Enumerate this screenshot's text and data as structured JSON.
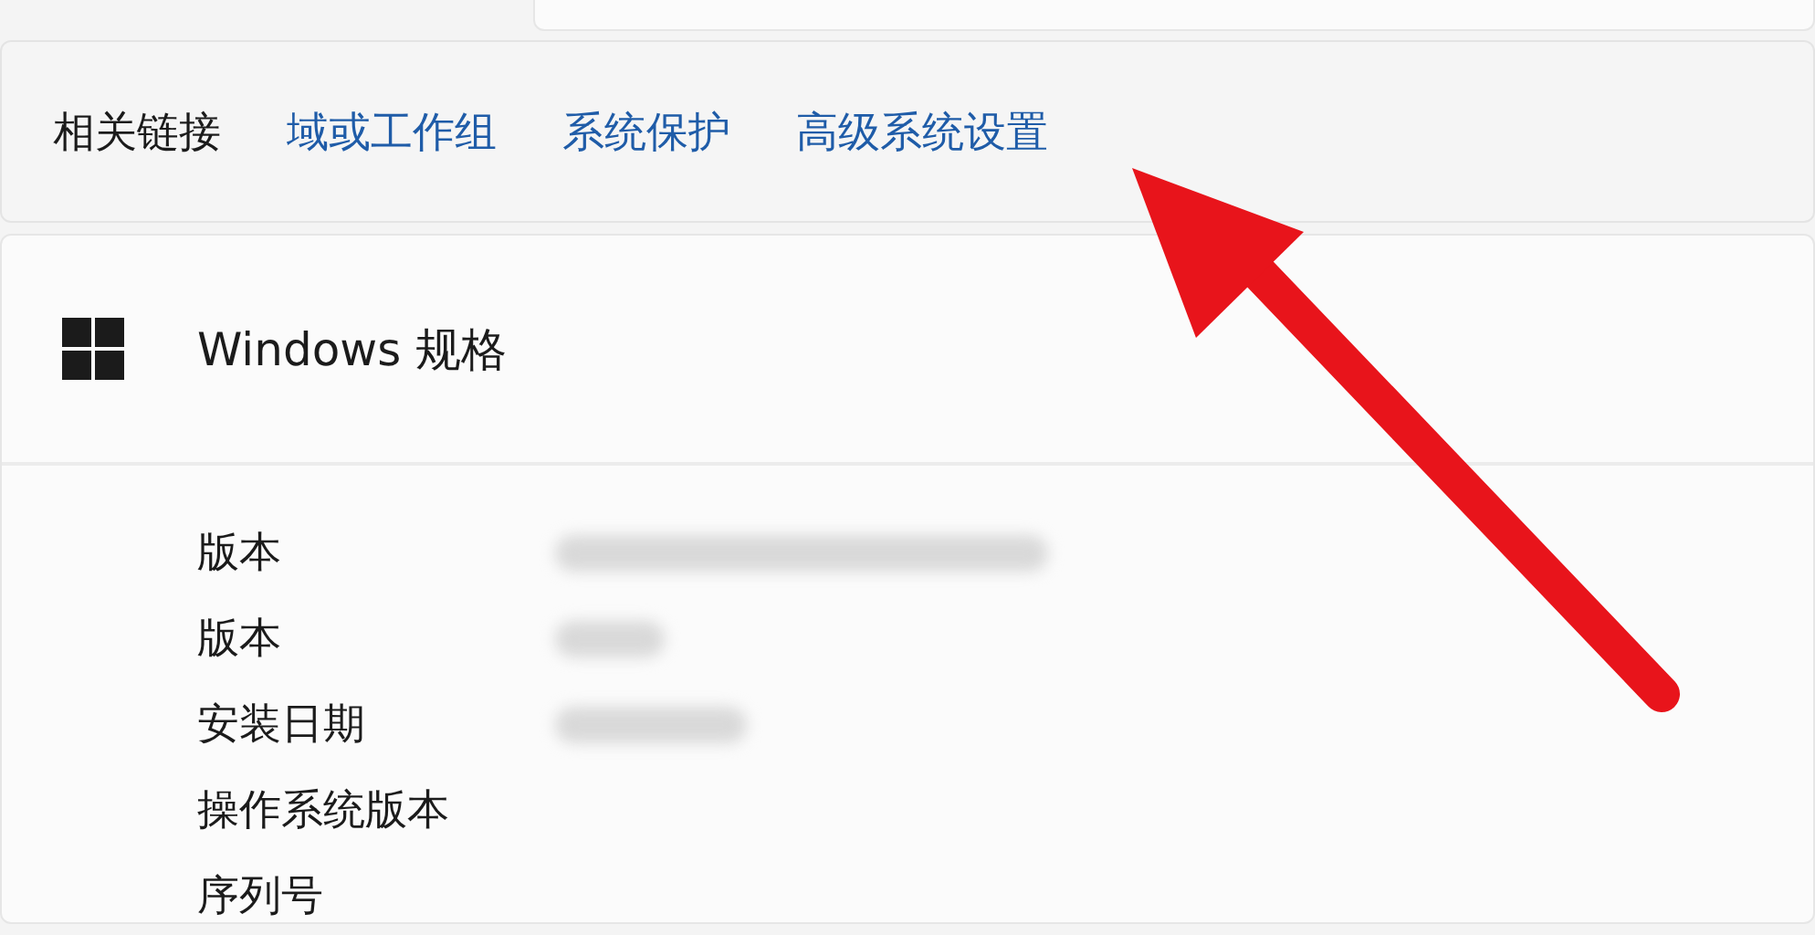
{
  "related_links": {
    "label": "相关链接",
    "links": [
      {
        "text": "域或工作组"
      },
      {
        "text": "系统保护"
      },
      {
        "text": "高级系统设置"
      }
    ]
  },
  "windows_spec": {
    "title": "Windows 规格",
    "rows": [
      {
        "label": "版本",
        "redacted": true
      },
      {
        "label": "版本",
        "redacted": true
      },
      {
        "label": "安装日期",
        "redacted": true
      },
      {
        "label": "操作系统版本",
        "redacted": false
      },
      {
        "label": "序列号",
        "redacted": false
      }
    ]
  },
  "annotations": [
    {
      "kind": "arrow"
    }
  ]
}
